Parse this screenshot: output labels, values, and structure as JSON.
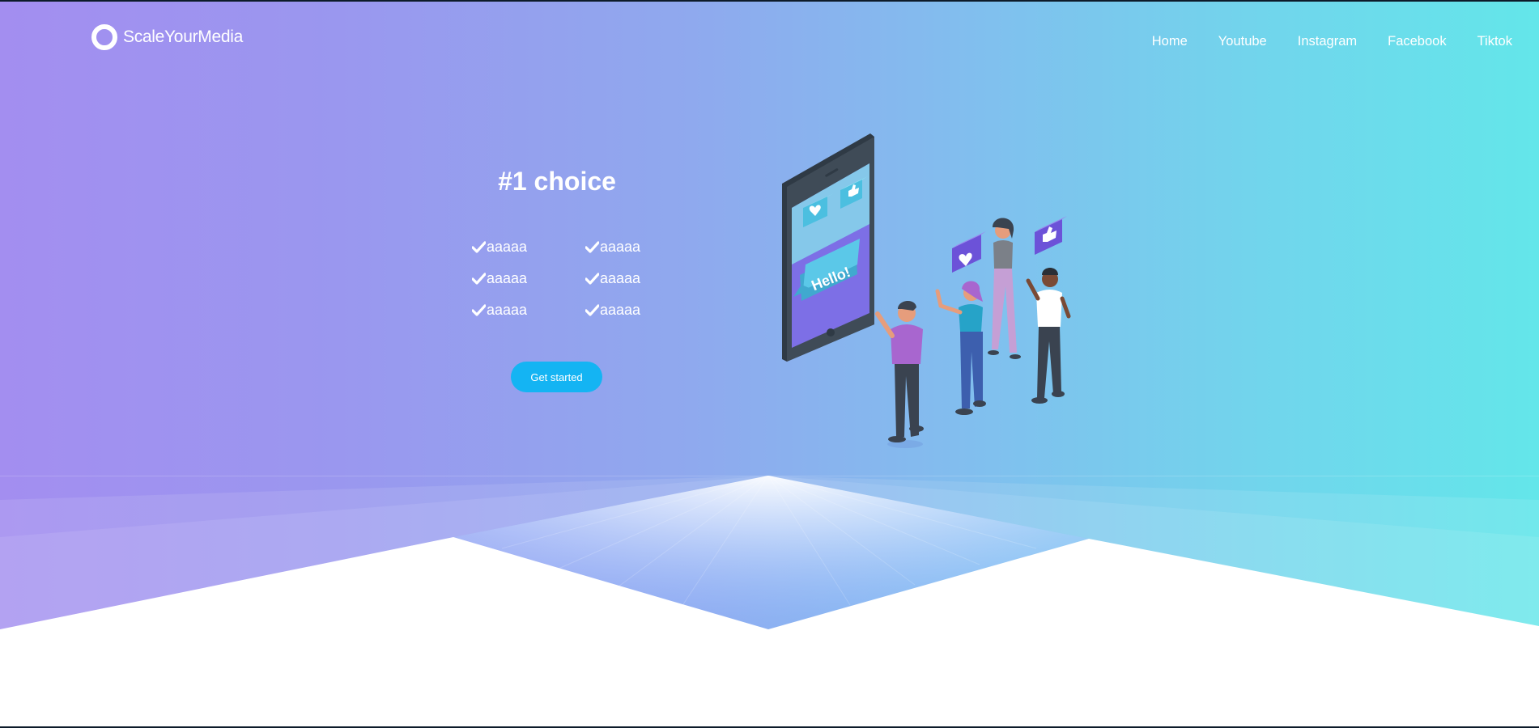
{
  "brand": {
    "name": "ScaleYourMedia"
  },
  "nav": {
    "items": [
      {
        "label": "Home"
      },
      {
        "label": "Youtube"
      },
      {
        "label": "Instagram"
      },
      {
        "label": "Facebook"
      },
      {
        "label": "Tiktok"
      }
    ]
  },
  "hero": {
    "title": "#1 choice",
    "features": [
      "aaaaa",
      "aaaaa",
      "aaaaa",
      "aaaaa",
      "aaaaa",
      "aaaaa"
    ],
    "cta_label": "Get started",
    "illustration": {
      "screen_bubble": "Hello!",
      "icons": [
        "heart-bubble-icon",
        "thumbs-up-bubble-icon"
      ]
    }
  },
  "colors": {
    "gradient_start": "#a38ef0",
    "gradient_end": "#63e6ea",
    "cta": "#14b4f3",
    "text": "#ffffff"
  }
}
